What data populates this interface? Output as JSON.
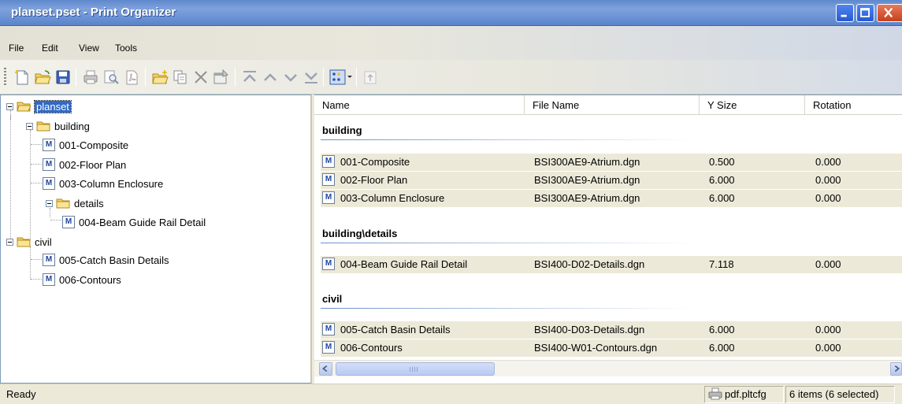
{
  "window": {
    "title": "planset.pset - Print Organizer"
  },
  "menu": {
    "items": [
      "File",
      "Edit",
      "View",
      "Tools"
    ]
  },
  "tree": {
    "root": "planset",
    "nodes": [
      {
        "label": "building"
      },
      {
        "label": "001-Composite"
      },
      {
        "label": "002-Floor Plan"
      },
      {
        "label": "003-Column Enclosure"
      },
      {
        "label": "details"
      },
      {
        "label": "004-Beam Guide Rail Detail"
      },
      {
        "label": "civil"
      },
      {
        "label": "005-Catch Basin Details"
      },
      {
        "label": "006-Contours"
      }
    ]
  },
  "list": {
    "columns": [
      "Name",
      "File Name",
      "Y Size",
      "Rotation"
    ],
    "groups": [
      {
        "label": "building",
        "rows": [
          {
            "name": "001-Composite",
            "file": "BSI300AE9-Atrium.dgn",
            "ysize": "0.500",
            "rotation": "0.000"
          },
          {
            "name": "002-Floor Plan",
            "file": "BSI300AE9-Atrium.dgn",
            "ysize": "6.000",
            "rotation": "0.000"
          },
          {
            "name": "003-Column Enclosure",
            "file": "BSI300AE9-Atrium.dgn",
            "ysize": "6.000",
            "rotation": "0.000"
          }
        ]
      },
      {
        "label": "building\\details",
        "rows": [
          {
            "name": "004-Beam Guide Rail Detail",
            "file": "BSI400-D02-Details.dgn",
            "ysize": "7.118",
            "rotation": "0.000"
          }
        ]
      },
      {
        "label": "civil",
        "rows": [
          {
            "name": "005-Catch Basin Details",
            "file": "BSI400-D03-Details.dgn",
            "ysize": "6.000",
            "rotation": "0.000"
          },
          {
            "name": "006-Contours",
            "file": "BSI400-W01-Contours.dgn",
            "ysize": "6.000",
            "rotation": "0.000"
          }
        ]
      }
    ]
  },
  "icons": {
    "doc_glyph": "M",
    "toolbar": [
      "new-icon",
      "open-icon",
      "save-icon",
      "print-icon",
      "preview-icon",
      "pdf-icon",
      "add-folder-icon",
      "add-files-icon",
      "delete-icon",
      "properties-icon",
      "move-to-top-icon",
      "move-up-icon",
      "move-down-icon",
      "move-to-bottom-icon",
      "view-mode-icon",
      "up-level-icon"
    ]
  },
  "status": {
    "text": "Ready",
    "printer": "pdf.pltcfg",
    "selection": "6 items (6 selected)"
  },
  "colors": {
    "titlebar": "#6b92d5",
    "selection": "#316ac5",
    "row_background": "#ece9d8",
    "folder": "#f2d36b"
  }
}
